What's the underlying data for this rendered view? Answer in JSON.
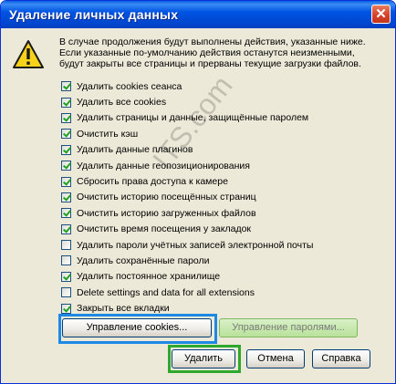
{
  "window": {
    "title": "Удаление личных данных",
    "close_symbol": "✕"
  },
  "warning": {
    "icon": "warning-triangle-icon",
    "lines": [
      "В случае продолжения будут выполнены действия, указанные ниже.",
      "Если указанные по-умолчанию действия останутся неизменными,",
      "будут закрыты все страницы и прерваны текущие загрузки файлов."
    ]
  },
  "options": [
    {
      "label": "Удалить cookies сеанса",
      "checked": true
    },
    {
      "label": "Удалить все cookies",
      "checked": true
    },
    {
      "label": "Удалить страницы и данные, защищённые паролем",
      "checked": true
    },
    {
      "label": "Очистить кэш",
      "checked": true
    },
    {
      "label": "Удалить данные плагинов",
      "checked": true
    },
    {
      "label": "Удалить данные геопозиционирования",
      "checked": true
    },
    {
      "label": "Сбросить права доступа к камере",
      "checked": true
    },
    {
      "label": "Очистить историю посещённых страниц",
      "checked": true
    },
    {
      "label": "Очистить историю загруженных файлов",
      "checked": true
    },
    {
      "label": "Очистить время посещения у закладок",
      "checked": true
    },
    {
      "label": "Удалить пароли учётных записей электронной почты",
      "checked": false
    },
    {
      "label": "Удалить сохранённые пароли",
      "checked": false
    },
    {
      "label": "Удалить постоянное хранилище",
      "checked": true
    },
    {
      "label": "Delete settings and data for all extensions",
      "checked": false
    },
    {
      "label": "Закрыть все вкладки",
      "checked": true
    }
  ],
  "buttons": {
    "manage_cookies": "Управление cookies...",
    "manage_passwords": "Управление паролями...",
    "delete": "Удалить",
    "cancel": "Отмена",
    "help": "Справка"
  },
  "watermark": "ITS.com",
  "colors": {
    "highlight_blue": "#1e88e5",
    "highlight_green": "#2ea82e",
    "titlebar": "#0054e3"
  }
}
